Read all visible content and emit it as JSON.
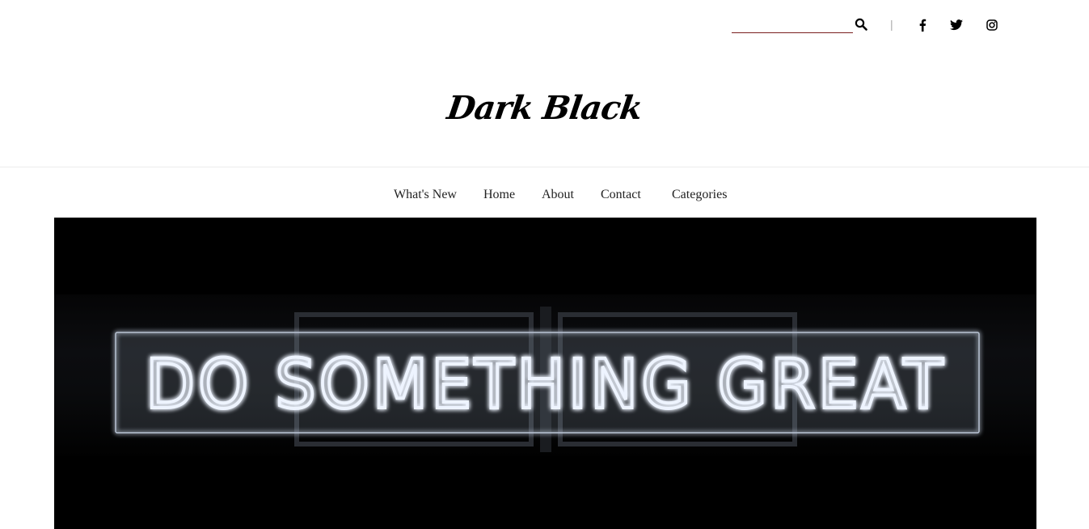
{
  "header": {
    "search": {
      "placeholder": "",
      "value": ""
    },
    "divider": "|",
    "social_icons": [
      "facebook-icon",
      "twitter-icon",
      "instagram-icon"
    ]
  },
  "brand": {
    "name": "Dark Black"
  },
  "nav": {
    "items": [
      "What's New",
      "Home",
      "About",
      "Contact",
      "Categories"
    ]
  },
  "hero": {
    "sign_text": "DO SOMETHING GREAT",
    "background_color": "#000000",
    "glow_color": "#e8f1ff"
  },
  "colors": {
    "accent": "#7a1f1f",
    "text": "#111111"
  }
}
